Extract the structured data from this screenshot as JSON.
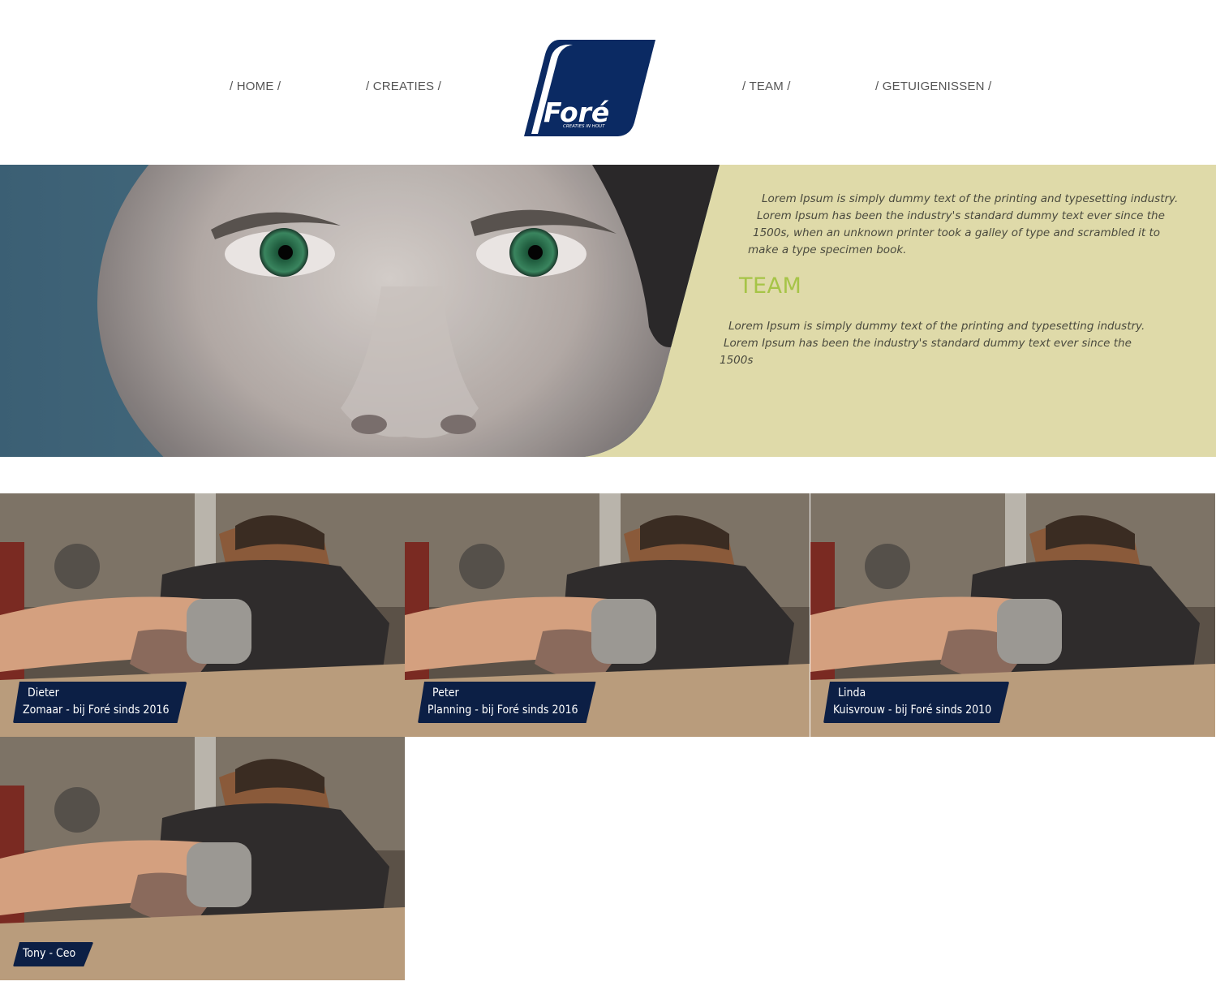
{
  "nav": {
    "home": "/ HOME /",
    "creaties": "/ CREATIES /",
    "team": "/ TEAM /",
    "getuigenissen": "/ GETUIGENISSEN /"
  },
  "logo": {
    "wordmark": "Foré",
    "tagline": "CREATIES IN HOUT",
    "color": "#0b2a63"
  },
  "hero": {
    "background_color": "#dfdaa9",
    "intro_lines": [
      "Lorem Ipsum is simply dummy text of the printing and typesetting industry.",
      "Lorem Ipsum has been the industry's standard dummy text ever since the",
      "1500s, when an unknown printer took a galley of type and scrambled it to",
      "make a type specimen book."
    ],
    "heading": "TEAM",
    "heading_color": "#a6c447",
    "body_lines": [
      "Lorem Ipsum is simply dummy text of the printing and typesetting industry.",
      "Lorem Ipsum has been the industry's standard dummy text ever since the",
      "1500s"
    ]
  },
  "team": [
    {
      "name": "Dieter",
      "role": "Zomaar - bij Foré sinds 2016"
    },
    {
      "name": "Peter",
      "role": "Planning - bij Foré sinds 2016"
    },
    {
      "name": "Linda",
      "role": "Kuisvrouw - bij Foré sinds 2010"
    },
    {
      "name": "",
      "role": "Tony - Ceo"
    }
  ],
  "caption_color": "#0c1f45"
}
